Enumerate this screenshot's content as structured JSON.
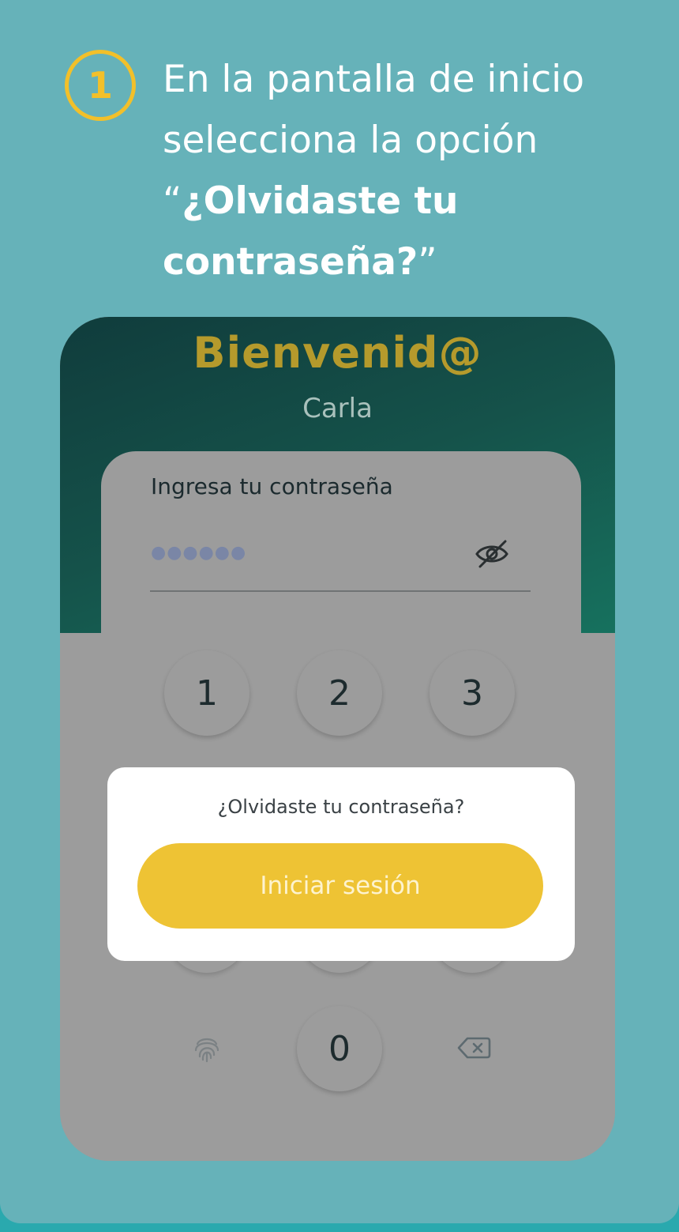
{
  "step": {
    "number": "1",
    "text_part1": "En la pantalla de inicio selecciona la opción “",
    "text_bold": "¿Olvidaste tu contraseña?",
    "text_part2": "”"
  },
  "app": {
    "welcome": "Bienvenid@",
    "username": "Carla",
    "password_label": "Ingresa tu contraseña",
    "password_dots": "●●●●●●",
    "keypad": {
      "row1": [
        "1",
        "2",
        "3"
      ],
      "zero": "0"
    },
    "icons": {
      "visibility": "eye-off-icon",
      "biometric": "fingerprint-icon",
      "delete": "backspace-icon"
    }
  },
  "modal": {
    "forgot_link": "¿Olvidaste tu contraseña?",
    "login_button": "Iniciar sesión"
  },
  "colors": {
    "background": "#66b2b9",
    "accent_yellow": "#eec334",
    "header_green": "#15524a"
  }
}
